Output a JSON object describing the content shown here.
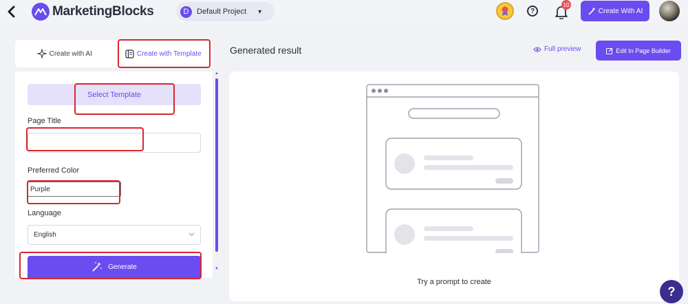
{
  "header": {
    "brand": "MarketingBlocks",
    "project_initial": "D",
    "project_name": "Default Project",
    "notification_count": "10",
    "create_ai_label": "Create With AI"
  },
  "left_tabs": [
    {
      "label": "Create with AI",
      "active": false
    },
    {
      "label": "Create with Template",
      "active": true
    }
  ],
  "form": {
    "select_template_label": "Select Template",
    "page_title_label": "Page Title",
    "page_title_value": "",
    "color_label": "Preferred Color",
    "color_value": "Purple",
    "language_label": "Language",
    "language_value": "English",
    "generate_label": "Generate"
  },
  "result": {
    "title": "Generated result",
    "full_preview_label": "Full preview",
    "edit_label": "Edit In Page Builder",
    "empty_message": "Try a prompt to create"
  },
  "help_fab_label": "?",
  "colors": {
    "accent": "#6a4cf0",
    "annotation": "#d7262e"
  }
}
